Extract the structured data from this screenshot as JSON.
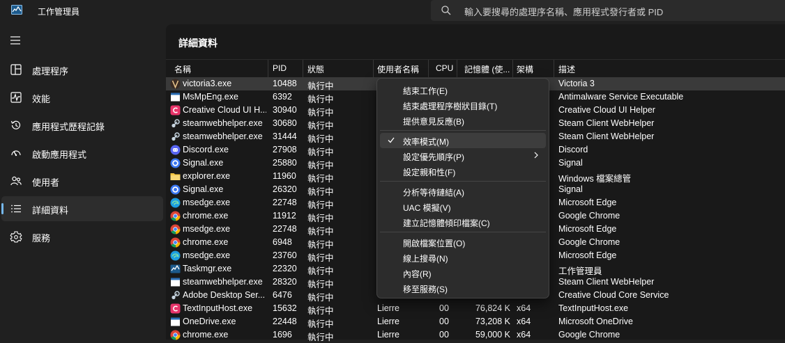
{
  "app": {
    "title": "工作管理員"
  },
  "search": {
    "placeholder": "輸入要搜尋的處理序名稱、應用程式發行者或 PID"
  },
  "sidebar": {
    "items": [
      {
        "label": "處理程序",
        "icon": "processes-icon",
        "active": false
      },
      {
        "label": "效能",
        "icon": "performance-icon",
        "active": false
      },
      {
        "label": "應用程式歷程記錄",
        "icon": "history-icon",
        "active": false
      },
      {
        "label": "啟動應用程式",
        "icon": "startup-icon",
        "active": false
      },
      {
        "label": "使用者",
        "icon": "users-icon",
        "active": false
      },
      {
        "label": "詳細資料",
        "icon": "details-icon",
        "active": true
      },
      {
        "label": "服務",
        "icon": "services-icon",
        "active": false
      }
    ]
  },
  "main": {
    "title": "詳細資料",
    "columns": [
      "名稱",
      "PID",
      "狀態",
      "使用者名稱",
      "CPU",
      "記憶體 (使...",
      "架構",
      "描述"
    ],
    "rows": [
      {
        "name": "victoria3.exe",
        "pid": "10488",
        "status": "執行中",
        "user": "",
        "cpu": "",
        "mem": "",
        "arch": "",
        "desc": "Victoria 3",
        "icon": "victoria-icon"
      },
      {
        "name": "MsMpEng.exe",
        "pid": "6392",
        "status": "執行中",
        "user": "",
        "cpu": "",
        "mem": "",
        "arch": "",
        "desc": "Antimalware Service Executable",
        "icon": "window-icon"
      },
      {
        "name": "Creative Cloud UI H...",
        "pid": "30940",
        "status": "執行中",
        "user": "",
        "cpu": "",
        "mem": "",
        "arch": "",
        "desc": "Creative Cloud UI Helper",
        "icon": "creative-cloud-icon"
      },
      {
        "name": "steamwebhelper.exe",
        "pid": "30680",
        "status": "執行中",
        "user": "",
        "cpu": "",
        "mem": "",
        "arch": "",
        "desc": "Steam Client WebHelper",
        "icon": "steam-icon"
      },
      {
        "name": "steamwebhelper.exe",
        "pid": "31444",
        "status": "執行中",
        "user": "",
        "cpu": "",
        "mem": "",
        "arch": "",
        "desc": "Steam Client WebHelper",
        "icon": "steam-icon"
      },
      {
        "name": "Discord.exe",
        "pid": "27908",
        "status": "執行中",
        "user": "",
        "cpu": "",
        "mem": "",
        "arch": "",
        "desc": "Discord",
        "icon": "discord-icon"
      },
      {
        "name": "Signal.exe",
        "pid": "25880",
        "status": "執行中",
        "user": "",
        "cpu": "",
        "mem": "",
        "arch": "",
        "desc": "Signal",
        "icon": "signal-icon"
      },
      {
        "name": "explorer.exe",
        "pid": "11960",
        "status": "執行中",
        "user": "",
        "cpu": "",
        "mem": "",
        "arch": "",
        "desc": "Windows 檔案總管",
        "icon": "folder-icon"
      },
      {
        "name": "Signal.exe",
        "pid": "26320",
        "status": "執行中",
        "user": "",
        "cpu": "",
        "mem": "",
        "arch": "",
        "desc": "Signal",
        "icon": "signal-icon"
      },
      {
        "name": "msedge.exe",
        "pid": "22748",
        "status": "執行中",
        "user": "",
        "cpu": "",
        "mem": "",
        "arch": "",
        "desc": "Microsoft Edge",
        "icon": "edge-icon"
      },
      {
        "name": "chrome.exe",
        "pid": "11912",
        "status": "執行中",
        "user": "",
        "cpu": "",
        "mem": "",
        "arch": "",
        "desc": "Google Chrome",
        "icon": "chrome-icon"
      },
      {
        "name": "msedge.exe",
        "pid": "22748",
        "status": "執行中",
        "user": "",
        "cpu": "",
        "mem": "",
        "arch": "",
        "desc": "Microsoft Edge",
        "icon": "chrome-icon"
      },
      {
        "name": "chrome.exe",
        "pid": "6948",
        "status": "執行中",
        "user": "",
        "cpu": "",
        "mem": "",
        "arch": "",
        "desc": "Google Chrome",
        "icon": "chrome-icon"
      },
      {
        "name": "msedge.exe",
        "pid": "23760",
        "status": "執行中",
        "user": "",
        "cpu": "",
        "mem": "",
        "arch": "",
        "desc": "Microsoft Edge",
        "icon": "edge-icon"
      },
      {
        "name": "Taskmgr.exe",
        "pid": "22320",
        "status": "執行中",
        "user": "",
        "cpu": "",
        "mem": "",
        "arch": "",
        "desc": "工作管理員",
        "icon": "taskmgr-icon"
      },
      {
        "name": "steamwebhelper.exe",
        "pid": "28320",
        "status": "執行中",
        "user": "",
        "cpu": "",
        "mem": "",
        "arch": "",
        "desc": "Steam Client WebHelper",
        "icon": "window-icon"
      },
      {
        "name": "Adobe Desktop Ser...",
        "pid": "6476",
        "status": "執行中",
        "user": "",
        "cpu": "",
        "mem": "",
        "arch": "",
        "desc": "Creative Cloud Core Service",
        "icon": "steam-icon"
      },
      {
        "name": "TextInputHost.exe",
        "pid": "15632",
        "status": "執行中",
        "user": "Lierre",
        "cpu": "00",
        "mem": "76,824 K",
        "arch": "x64",
        "desc": "TextInputHost.exe",
        "icon": "creative-cloud-icon"
      },
      {
        "name": "OneDrive.exe",
        "pid": "22448",
        "status": "執行中",
        "user": "Lierre",
        "cpu": "00",
        "mem": "73,208 K",
        "arch": "x64",
        "desc": "Microsoft OneDrive",
        "icon": "window-icon"
      },
      {
        "name": "chrome.exe",
        "pid": "1696",
        "status": "執行中",
        "user": "Lierre",
        "cpu": "00",
        "mem": "59,000 K",
        "arch": "x64",
        "desc": "Google Chrome",
        "icon": "chrome-icon"
      }
    ]
  },
  "context_menu": {
    "groups": [
      [
        {
          "label": "結束工作(E)"
        },
        {
          "label": "結束處理程序樹狀目錄(T)"
        },
        {
          "label": "提供意見反應(B)"
        }
      ],
      [
        {
          "label": "效率模式(M)",
          "checked": true,
          "highlighted": true
        },
        {
          "label": "設定優先順序(P)",
          "submenu": true
        },
        {
          "label": "設定親和性(F)"
        }
      ],
      [
        {
          "label": "分析等待鏈結(A)"
        },
        {
          "label": "UAC 模擬(V)"
        },
        {
          "label": "建立記憶體傾印檔案(C)"
        }
      ],
      [
        {
          "label": "開啟檔案位置(O)"
        },
        {
          "label": "線上搜尋(N)"
        },
        {
          "label": "內容(R)"
        },
        {
          "label": "移至服務(S)"
        }
      ]
    ]
  },
  "colors": {
    "accent": "#76b9ed",
    "background": "#202020",
    "content": "#191919",
    "menu": "#2c2c2c"
  }
}
